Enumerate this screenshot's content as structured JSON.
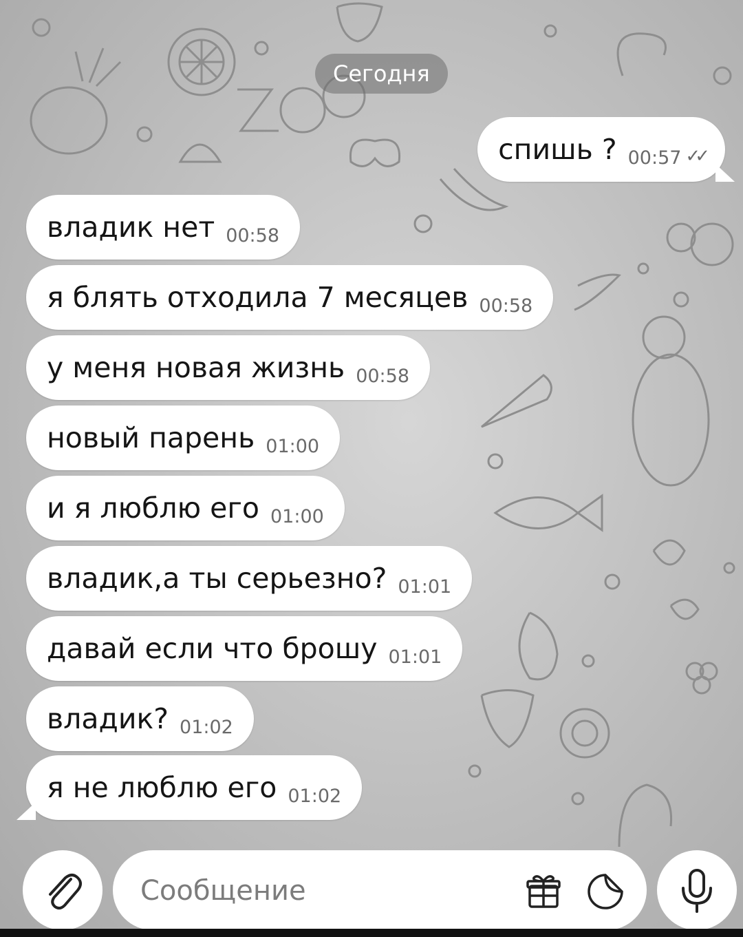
{
  "chat": {
    "date_label": "Сегодня",
    "outgoing": [
      {
        "text": "спишь ?",
        "time": "00:57",
        "read_ticks": "✓✓"
      }
    ],
    "incoming": [
      {
        "text": "владик нет",
        "time": "00:58"
      },
      {
        "text": "я блять отходила 7 месяцев",
        "time": "00:58"
      },
      {
        "text": "у меня новая жизнь",
        "time": "00:58"
      },
      {
        "text": "новый парень",
        "time": "01:00"
      },
      {
        "text": "и я люблю его",
        "time": "01:00"
      },
      {
        "text": "владик,а ты серьезно?",
        "time": "01:01"
      },
      {
        "text": "давай если что брошу",
        "time": "01:01"
      },
      {
        "text": "владик?",
        "time": "01:02"
      },
      {
        "text": "я не люблю его",
        "time": "01:02"
      }
    ]
  },
  "composer": {
    "placeholder": "Сообщение",
    "attach_icon": "paperclip-icon",
    "gift_icon": "gift-icon",
    "sticker_icon": "sticker-icon",
    "mic_icon": "microphone-icon"
  },
  "colors": {
    "bubble": "#ffffff",
    "time_text": "#6a6a6a",
    "date_chip": "#6e6e6e"
  }
}
